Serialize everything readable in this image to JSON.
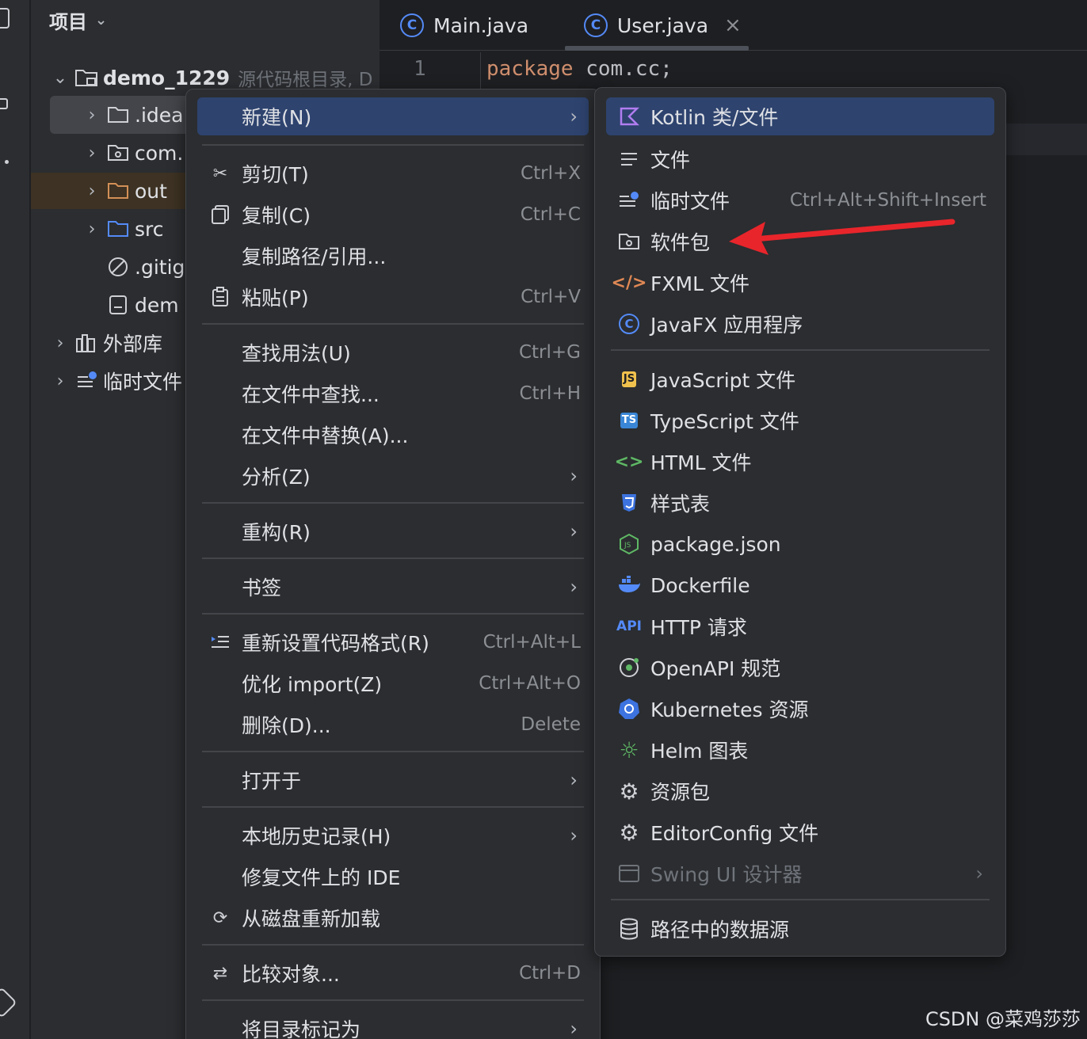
{
  "project_panel": {
    "title": "项目",
    "tree": [
      {
        "label": "demo_1229",
        "hint": "源代码根目录, D"
      },
      {
        "label": ".idea"
      },
      {
        "label": "com."
      },
      {
        "label": "out"
      },
      {
        "label": "src"
      },
      {
        "label": ".gitig"
      },
      {
        "label": "dem"
      },
      {
        "label": "外部库"
      },
      {
        "label": "临时文件"
      }
    ]
  },
  "editor": {
    "tabs": [
      {
        "label": "Main.java"
      },
      {
        "label": "User.java",
        "close": "×"
      }
    ],
    "line_number": "1",
    "code_keyword": "package",
    "code_rest": " com.cc;"
  },
  "context_menu": {
    "items": [
      {
        "label": "新建(N)",
        "shortcut": "",
        "arrow": "›",
        "icon": ""
      },
      {
        "label": "剪切(T)",
        "shortcut": "Ctrl+X",
        "icon": "scissors-icon"
      },
      {
        "label": "复制(C)",
        "shortcut": "Ctrl+C",
        "icon": "copy-icon"
      },
      {
        "label": "复制路径/引用...",
        "shortcut": ""
      },
      {
        "label": "粘贴(P)",
        "shortcut": "Ctrl+V",
        "icon": "paste-icon"
      },
      {
        "label": "查找用法(U)",
        "shortcut": "Ctrl+G"
      },
      {
        "label": "在文件中查找...",
        "shortcut": "Ctrl+H"
      },
      {
        "label": "在文件中替换(A)...",
        "shortcut": ""
      },
      {
        "label": "分析(Z)",
        "arrow": "›"
      },
      {
        "label": "重构(R)",
        "arrow": "›"
      },
      {
        "label": "书签",
        "arrow": "›"
      },
      {
        "label": "重新设置代码格式(R)",
        "shortcut": "Ctrl+Alt+L",
        "icon": "reformat-icon"
      },
      {
        "label": "优化 import(Z)",
        "shortcut": "Ctrl+Alt+O"
      },
      {
        "label": "删除(D)...",
        "shortcut": "Delete"
      },
      {
        "label": "打开于",
        "arrow": "›"
      },
      {
        "label": "本地历史记录(H)",
        "arrow": "›"
      },
      {
        "label": "修复文件上的 IDE"
      },
      {
        "label": "从磁盘重新加载",
        "icon": "reload-icon"
      },
      {
        "label": "比较对象...",
        "shortcut": "Ctrl+D",
        "icon": "compare-icon"
      },
      {
        "label": "将目录标记为",
        "arrow": "›"
      }
    ]
  },
  "new_submenu": {
    "items": [
      {
        "label": "Kotlin 类/文件"
      },
      {
        "label": "文件"
      },
      {
        "label": "临时文件",
        "shortcut": "Ctrl+Alt+Shift+Insert"
      },
      {
        "label": "软件包"
      },
      {
        "label": "FXML 文件"
      },
      {
        "label": "JavaFX 应用程序"
      },
      {
        "label": "JavaScript 文件",
        "badge": "JS"
      },
      {
        "label": "TypeScript 文件",
        "badge": "TS"
      },
      {
        "label": "HTML 文件"
      },
      {
        "label": "样式表"
      },
      {
        "label": "package.json"
      },
      {
        "label": "Dockerfile"
      },
      {
        "label": "HTTP 请求",
        "badge": "API"
      },
      {
        "label": "OpenAPI 规范"
      },
      {
        "label": "Kubernetes 资源"
      },
      {
        "label": "Helm 图表"
      },
      {
        "label": "资源包"
      },
      {
        "label": "EditorConfig 文件"
      },
      {
        "label": "Swing UI 设计器",
        "arrow": "›"
      },
      {
        "label": "路径中的数据源"
      }
    ]
  },
  "watermark": "CSDN @菜鸡莎莎",
  "colors": {
    "background": "#1e1f22",
    "panel": "#2b2d30",
    "selection": "#2e436e",
    "accent": "#548af7",
    "annotation_arrow": "#e8252b"
  }
}
